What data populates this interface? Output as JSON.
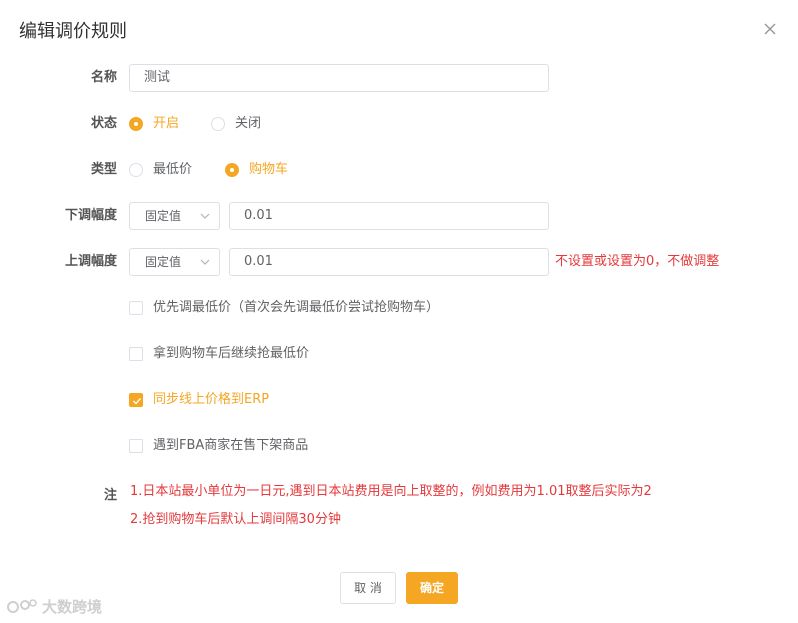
{
  "dialog": {
    "title": "编辑调价规则",
    "close_icon": "close-icon"
  },
  "form": {
    "name": {
      "label": "名称",
      "value": "测试"
    },
    "status": {
      "label": "状态",
      "options": [
        {
          "label": "开启",
          "checked": true
        },
        {
          "label": "关闭",
          "checked": false
        }
      ]
    },
    "type": {
      "label": "类型",
      "options": [
        {
          "label": "最低价",
          "checked": false
        },
        {
          "label": "购物车",
          "checked": true
        }
      ]
    },
    "down_range": {
      "label": "下调幅度",
      "mode": "固定值",
      "value": "0.01"
    },
    "up_range": {
      "label": "上调幅度",
      "mode": "固定值",
      "value": "0.01",
      "hint": "不设置或设置为0，不做调整"
    },
    "checkboxes": [
      {
        "label": "优先调最低价（首次会先调最低价尝试抢购物车）",
        "checked": false
      },
      {
        "label": "拿到购物车后继续抢最低价",
        "checked": false
      },
      {
        "label": "同步线上价格到ERP",
        "checked": true
      },
      {
        "label": "遇到FBA商家在售下架商品",
        "checked": false
      }
    ],
    "note": {
      "label": "注",
      "lines": [
        "1.日本站最小单位为一日元,遇到日本站费用是向上取整的，例如费用为1.01取整后实际为2",
        "2.抢到购物车后默认上调间隔30分钟"
      ]
    }
  },
  "footer": {
    "cancel_label": "取 消",
    "confirm_label": "确定"
  },
  "watermark": {
    "text": "大数跨境"
  },
  "colors": {
    "accent": "#f5a623",
    "danger": "#e4393c",
    "border": "#dcdfe6"
  }
}
